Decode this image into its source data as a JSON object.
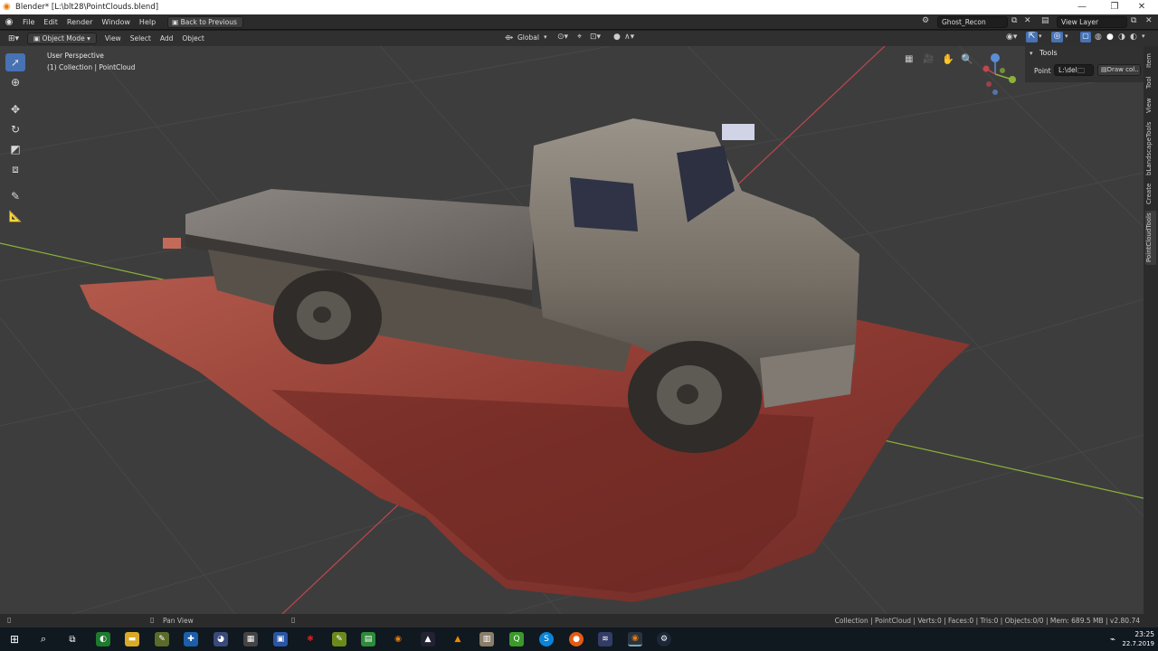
{
  "window": {
    "title": "Blender* [L:\\blt28\\PointClouds.blend]",
    "minimize": "—",
    "maximize": "❐",
    "close": "✕"
  },
  "menubar": {
    "items": [
      "File",
      "Edit",
      "Render",
      "Window",
      "Help"
    ],
    "back_button": "Back to Previous",
    "scene_name": "Ghost_Recon",
    "view_layer": "View Layer"
  },
  "viewport_header": {
    "mode": "Object Mode",
    "items": [
      "View",
      "Select",
      "Add",
      "Object"
    ],
    "transform_orientation": "Global"
  },
  "viewport": {
    "perspective_label": "User Perspective",
    "collection_label": "(1) Collection | PointCloud"
  },
  "npanel": {
    "section": "Tools",
    "point_label": "Point",
    "point_value": "L:\\del",
    "draw_button": "Draw col..",
    "tabs": [
      "Item",
      "Tool",
      "View",
      "bLandscapeTools",
      "Create",
      "PointCloudTools"
    ]
  },
  "statusbar": {
    "left": "Pan View",
    "right": "Collection | PointCloud | Verts:0 | Faces:0 | Tris:0 | Objects:0/0 | Mem: 689.5 MB | v2.80.74"
  },
  "taskbar": {
    "time": "23:25",
    "date": "22.7.2019"
  },
  "colors": {
    "accent": "#4772b3",
    "viewport_bg": "#3d3d3d",
    "grid": "#474747",
    "x_axis": "#c2464f",
    "y_axis": "#8bb236"
  }
}
